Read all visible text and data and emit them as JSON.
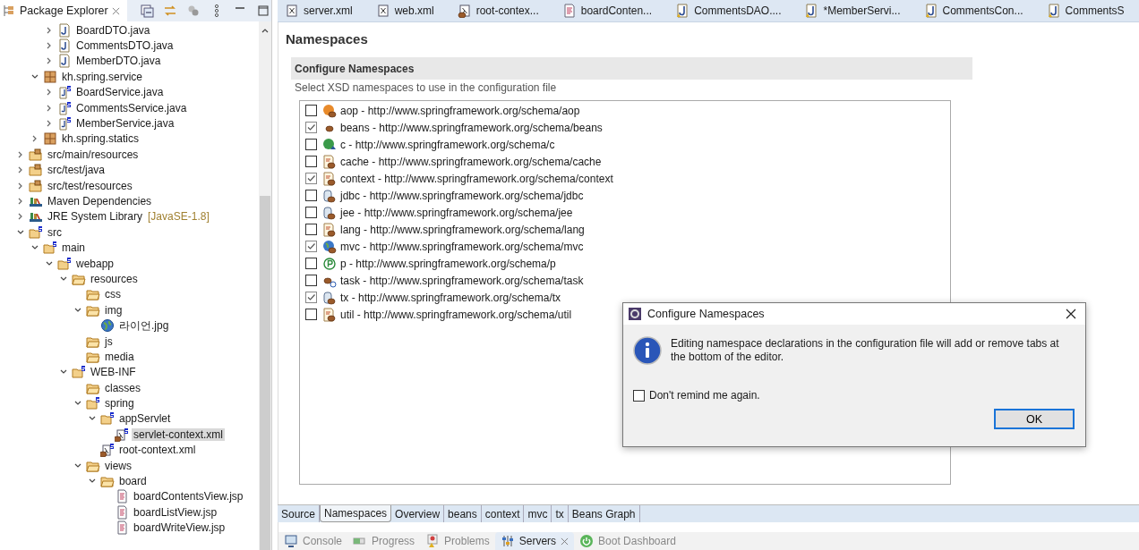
{
  "explorer": {
    "title": "Package Explorer",
    "tree": [
      {
        "children": [
          {
            "children": [
              {
                "label": "BoardDTO.java",
                "kind": "java",
                "expanded": false,
                "selected": false
              },
              {
                "label": "CommentsDTO.java",
                "kind": "java",
                "expanded": false,
                "selected": false
              },
              {
                "label": "MemberDTO.java",
                "kind": "java",
                "expanded": false,
                "selected": false
              }
            ]
          },
          {
            "label": "kh.spring.service",
            "kind": "package",
            "expanded": true,
            "selected": false,
            "children": [
              {
                "label": "BoardService.java",
                "kind": "java-spring",
                "expanded": false,
                "selected": false
              },
              {
                "label": "CommentsService.java",
                "kind": "java-spring",
                "expanded": false,
                "selected": false
              },
              {
                "label": "MemberService.java",
                "kind": "java-spring",
                "expanded": false,
                "selected": false
              }
            ]
          },
          {
            "label": "kh.spring.statics",
            "kind": "package",
            "expanded": false,
            "selected": false
          }
        ]
      },
      {
        "label": "src/main/resources",
        "kind": "source-folder",
        "expanded": false,
        "selected": false
      },
      {
        "label": "src/test/java",
        "kind": "source-folder",
        "expanded": false,
        "selected": false
      },
      {
        "label": "src/test/resources",
        "kind": "source-folder",
        "expanded": false,
        "selected": false
      },
      {
        "label": "Maven Dependencies",
        "kind": "library",
        "expanded": false,
        "selected": false
      },
      {
        "label": "JRE System Library",
        "decoration": "[JavaSE-1.8]",
        "kind": "library",
        "expanded": false,
        "selected": false
      },
      {
        "label": "src",
        "kind": "spring-folder",
        "expanded": true,
        "selected": false,
        "children": [
          {
            "label": "main",
            "kind": "spring-folder",
            "expanded": true,
            "selected": false,
            "children": [
              {
                "label": "webapp",
                "kind": "spring-folder",
                "expanded": true,
                "selected": false,
                "children": [
                  {
                    "label": "resources",
                    "kind": "folder",
                    "expanded": true,
                    "selected": false,
                    "children": [
                      {
                        "label": "css",
                        "kind": "folder",
                        "selected": false
                      },
                      {
                        "label": "img",
                        "kind": "folder",
                        "expanded": true,
                        "selected": false,
                        "children": [
                          {
                            "label": "라이언.jpg",
                            "kind": "image",
                            "selected": false
                          }
                        ]
                      },
                      {
                        "label": "js",
                        "kind": "folder",
                        "selected": false
                      },
                      {
                        "label": "media",
                        "kind": "folder",
                        "selected": false
                      }
                    ]
                  },
                  {
                    "label": "WEB-INF",
                    "kind": "spring-folder",
                    "expanded": true,
                    "selected": false,
                    "children": [
                      {
                        "label": "classes",
                        "kind": "folder",
                        "selected": false
                      },
                      {
                        "label": "spring",
                        "kind": "spring-folder",
                        "expanded": true,
                        "selected": false,
                        "children": [
                          {
                            "label": "appServlet",
                            "kind": "spring-folder",
                            "expanded": true,
                            "selected": false,
                            "children": [
                              {
                                "label": "servlet-context.xml",
                                "kind": "spring-xml",
                                "selected": true
                              }
                            ]
                          },
                          {
                            "label": "root-context.xml",
                            "kind": "spring-xml",
                            "selected": false
                          }
                        ]
                      },
                      {
                        "label": "views",
                        "kind": "folder",
                        "expanded": true,
                        "selected": false,
                        "children": [
                          {
                            "label": "board",
                            "kind": "folder",
                            "expanded": true,
                            "selected": false,
                            "children": [
                              {
                                "label": "boardContentsView.jsp",
                                "kind": "jsp",
                                "selected": false
                              },
                              {
                                "label": "boardListView.jsp",
                                "kind": "jsp",
                                "selected": false
                              },
                              {
                                "label": "boardWriteView.jsp",
                                "kind": "jsp",
                                "selected": false
                              }
                            ]
                          }
                        ]
                      }
                    ]
                  }
                ]
              }
            ]
          }
        ]
      }
    ]
  },
  "editor_tabs": [
    {
      "label": "server.xml",
      "kind": "xml"
    },
    {
      "label": "web.xml",
      "kind": "xml"
    },
    {
      "label": "root-contex...",
      "kind": "spring-xml"
    },
    {
      "label": "boardConten...",
      "kind": "jsp"
    },
    {
      "label": "CommentsDAO....",
      "kind": "java"
    },
    {
      "label": "*MemberServi...",
      "kind": "java"
    },
    {
      "label": "CommentsCon...",
      "kind": "java"
    },
    {
      "label": "CommentsS",
      "kind": "java"
    }
  ],
  "page": {
    "title": "Namespaces",
    "section_title": "Configure Namespaces",
    "description": "Select XSD namespaces to use in the configuration file",
    "namespaces": [
      {
        "label": "aop - http://www.springframework.org/schema/aop",
        "kind": "aop",
        "checked": false
      },
      {
        "label": "beans - http://www.springframework.org/schema/beans",
        "kind": "bean",
        "checked": true
      },
      {
        "label": "c - http://www.springframework.org/schema/c",
        "kind": "c",
        "checked": false
      },
      {
        "label": "cache - http://www.springframework.org/schema/cache",
        "kind": "doc",
        "checked": false
      },
      {
        "label": "context - http://www.springframework.org/schema/context",
        "kind": "doc",
        "checked": true
      },
      {
        "label": "jdbc - http://www.springframework.org/schema/jdbc",
        "kind": "db",
        "checked": false
      },
      {
        "label": "jee - http://www.springframework.org/schema/jee",
        "kind": "db",
        "checked": false
      },
      {
        "label": "lang - http://www.springframework.org/schema/lang",
        "kind": "doc",
        "checked": false
      },
      {
        "label": "mvc - http://www.springframework.org/schema/mvc",
        "kind": "globe",
        "checked": true
      },
      {
        "label": "p - http://www.springframework.org/schema/p",
        "kind": "p",
        "checked": false
      },
      {
        "label": "task - http://www.springframework.org/schema/task",
        "kind": "task",
        "checked": false
      },
      {
        "label": "tx - http://www.springframework.org/schema/tx",
        "kind": "db",
        "checked": true
      },
      {
        "label": "util - http://www.springframework.org/schema/util",
        "kind": "doc",
        "checked": false
      }
    ]
  },
  "page_tabs": [
    {
      "label": "Source",
      "selected": false
    },
    {
      "label": "Namespaces",
      "selected": true
    },
    {
      "label": "Overview",
      "selected": false
    },
    {
      "label": "beans",
      "selected": false
    },
    {
      "label": "context",
      "selected": false
    },
    {
      "label": "mvc",
      "selected": false
    },
    {
      "label": "tx",
      "selected": false
    },
    {
      "label": "Beans Graph",
      "selected": false
    }
  ],
  "bottom_tabs": [
    {
      "label": "Console",
      "kind": "console",
      "selected": false
    },
    {
      "label": "Progress",
      "kind": "progress",
      "selected": false
    },
    {
      "label": "Problems",
      "kind": "problems",
      "selected": false
    },
    {
      "label": "Servers",
      "kind": "servers",
      "selected": true
    },
    {
      "label": "Boot Dashboard",
      "kind": "boot",
      "selected": false
    }
  ],
  "dialog": {
    "title": "Configure Namespaces",
    "message": "Editing namespace declarations in the configuration file will add or remove tabs at the bottom of the editor.",
    "checkbox": {
      "label": "Don't remind me again.",
      "checked": false
    },
    "button": "OK"
  }
}
